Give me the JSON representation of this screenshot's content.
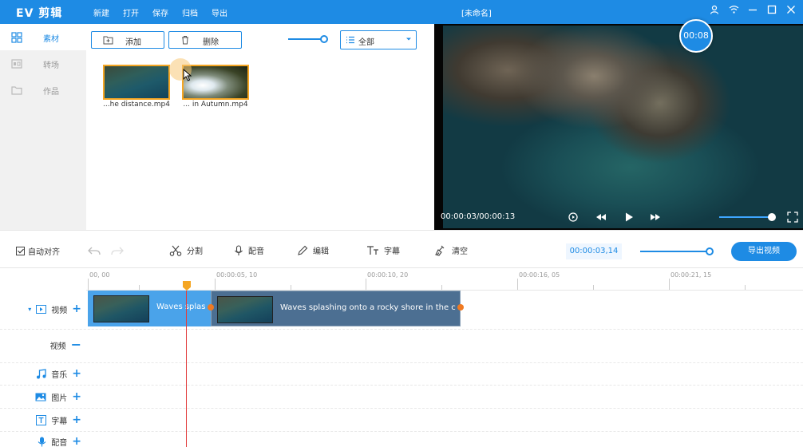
{
  "app": {
    "logo": "EV 剪辑",
    "menu": [
      "新建",
      "打开",
      "保存",
      "归档",
      "导出"
    ],
    "doc_title": "[未命名]",
    "accent_color": "#1e8be4",
    "window_icons": [
      "user-icon",
      "wifi-icon",
      "minimize-icon",
      "maximize-icon",
      "close-icon"
    ]
  },
  "sidebar": {
    "items": [
      {
        "label": "素材",
        "icon": "grid-icon",
        "active": true
      },
      {
        "label": "转场",
        "icon": "transition-icon",
        "active": false
      },
      {
        "label": "作品",
        "icon": "folder-icon",
        "active": false
      }
    ]
  },
  "media": {
    "add_label": "添加",
    "delete_label": "删除",
    "filter_label": "全部",
    "files": [
      {
        "name": "...he distance.mp4"
      },
      {
        "name": "... in Autumn.mp4"
      }
    ]
  },
  "preview": {
    "bubble_time": "00:08",
    "time_readout": "00:00:03/00:00:13",
    "volume_level": 1.0
  },
  "toolbar": {
    "auto_align": "自动对齐",
    "split": "分割",
    "dub": "配音",
    "edit": "编辑",
    "subtitle": "字幕",
    "clear": "清空",
    "current_time": "00:00:03,14",
    "export": "导出视频"
  },
  "timeline": {
    "ruler_labels": [
      "00, 00",
      "00:00:05, 10",
      "00:00:10, 20",
      "00:00:16, 05",
      "00:00:21, 15"
    ],
    "tracks": [
      {
        "label": "视频",
        "control": "+",
        "expand": "▾"
      },
      {
        "label": "视频",
        "control": "−"
      },
      {
        "label": "音乐",
        "control": "+"
      },
      {
        "label": "图片",
        "control": "+"
      },
      {
        "label": "字幕",
        "control": "+"
      },
      {
        "label": "配音",
        "control": "+"
      }
    ],
    "clips": [
      {
        "text": "Waves splas"
      },
      {
        "text": "Waves splashing onto a rocky shore in the c"
      }
    ]
  }
}
